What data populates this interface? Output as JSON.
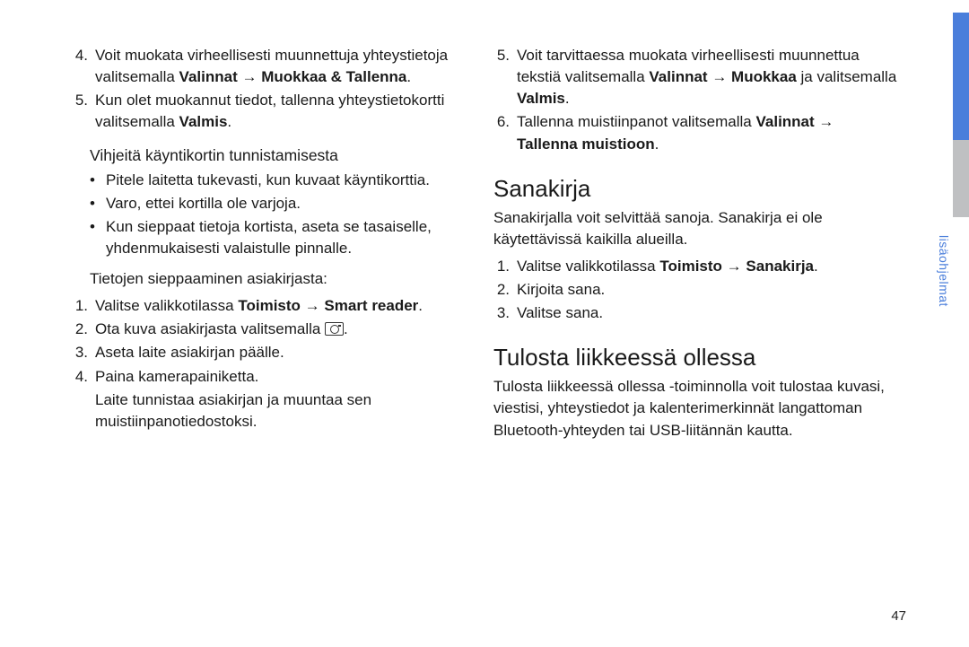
{
  "sidebar": {
    "label": "lisäohjelmat"
  },
  "pageNumber": "47",
  "left": {
    "ol1": [
      {
        "n": "4.",
        "parts": [
          "Voit muokata virheellisesti muunnettuja yhteystietoja valitsemalla ",
          {
            "b": "Valinnat"
          },
          " ",
          {
            "a": "→"
          },
          " ",
          {
            "b": "Muokkaa & Tallenna"
          },
          "."
        ]
      },
      {
        "n": "5.",
        "parts": [
          "Kun olet muokannut tiedot, tallenna yhteystietokortti valitsemalla ",
          {
            "b": "Valmis"
          },
          "."
        ]
      }
    ],
    "subhead1": "Vihjeitä käyntikortin tunnistamisesta",
    "ul1": [
      [
        "Pitele laitetta tukevasti, kun kuvaat käyntikorttia."
      ],
      [
        "Varo, ettei kortilla ole varjoja."
      ],
      [
        "Kun sieppaat tietoja kortista, aseta se tasaiselle, yhdenmukaisesti valaistulle pinnalle."
      ]
    ],
    "lead2": "Tietojen sieppaaminen asiakirjasta:",
    "ol2": [
      {
        "n": "1.",
        "parts": [
          "Valitse valikkotilassa ",
          {
            "b": "Toimisto"
          },
          " ",
          {
            "a": "→"
          },
          " ",
          {
            "b": "Smart reader"
          },
          "."
        ]
      },
      {
        "n": "2.",
        "parts": [
          "Ota kuva asiakirjasta valitsemalla ",
          {
            "icon": "camera"
          },
          "."
        ]
      },
      {
        "n": "3.",
        "parts": [
          "Aseta laite asiakirjan päälle."
        ]
      },
      {
        "n": "4.",
        "parts": [
          "Paina kamerapainiketta."
        ],
        "note": "Laite tunnistaa asiakirjan ja muuntaa sen muistiinpanotiedostoksi."
      }
    ]
  },
  "right": {
    "ol1": [
      {
        "n": "5.",
        "parts": [
          "Voit tarvittaessa muokata virheellisesti muunnettua tekstiä valitsemalla ",
          {
            "b": "Valinnat"
          },
          " ",
          {
            "a": "→"
          },
          " ",
          {
            "b": "Muokkaa"
          },
          " ja valitsemalla ",
          {
            "b": "Valmis"
          },
          "."
        ]
      },
      {
        "n": "6.",
        "parts": [
          "Tallenna muistiinpanot valitsemalla ",
          {
            "b": "Valinnat"
          },
          " ",
          {
            "a": "→"
          },
          " ",
          {
            "b": "Tallenna muistioon"
          },
          "."
        ]
      }
    ],
    "h2a": "Sanakirja",
    "paraA": "Sanakirjalla voit selvittää sanoja. Sanakirja ei ole käytettävissä kaikilla alueilla.",
    "ol2": [
      {
        "n": "1.",
        "parts": [
          "Valitse valikkotilassa ",
          {
            "b": "Toimisto"
          },
          " ",
          {
            "a": "→"
          },
          " ",
          {
            "b": "Sanakirja"
          },
          "."
        ]
      },
      {
        "n": "2.",
        "parts": [
          "Kirjoita sana."
        ]
      },
      {
        "n": "3.",
        "parts": [
          "Valitse sana."
        ]
      }
    ],
    "h2b": "Tulosta liikkeessä ollessa",
    "paraB": "Tulosta liikkeessä ollessa -toiminnolla voit tulostaa kuvasi, viestisi, yhteystiedot ja kalenterimerkinnät langattoman Bluetooth-yhteyden tai USB-liitännän kautta."
  }
}
